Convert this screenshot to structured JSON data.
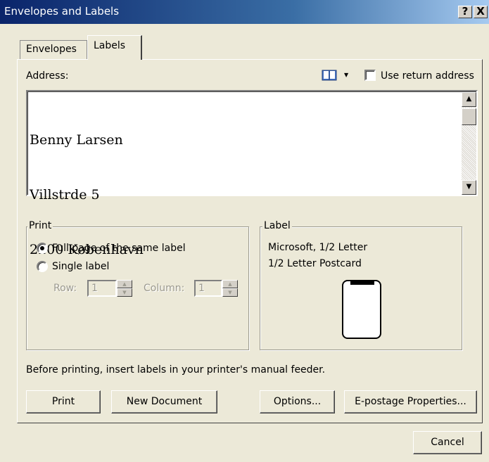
{
  "window": {
    "title": "Envelopes and Labels",
    "help_button": "?",
    "close_button": "X"
  },
  "tabs": [
    {
      "label": "Envelopes",
      "active": false
    },
    {
      "label": "Labels",
      "active": true
    }
  ],
  "address": {
    "label": "Address:",
    "lines": [
      "Benny Larsen",
      "Villstrde 5",
      "2200 København"
    ],
    "use_return_address_label": "Use return address",
    "use_return_address_checked": false,
    "address_book_icon": "address-book-icon"
  },
  "print_group": {
    "legend": "Print",
    "options": [
      {
        "label": "Full page of the same label",
        "selected": true
      },
      {
        "label": "Single label",
        "selected": false
      }
    ],
    "row_label": "Row:",
    "row_value": "1",
    "column_label": "Column:",
    "column_value": "1"
  },
  "label_group": {
    "legend": "Label",
    "vendor": "Microsoft, 1/2 Letter",
    "product": "1/2 Letter Postcard"
  },
  "hint": "Before printing, insert labels in your printer's manual feeder.",
  "buttons": {
    "print": "Print",
    "new_document": "New Document",
    "options": "Options...",
    "epostage": "E-postage Properties...",
    "cancel": "Cancel"
  }
}
